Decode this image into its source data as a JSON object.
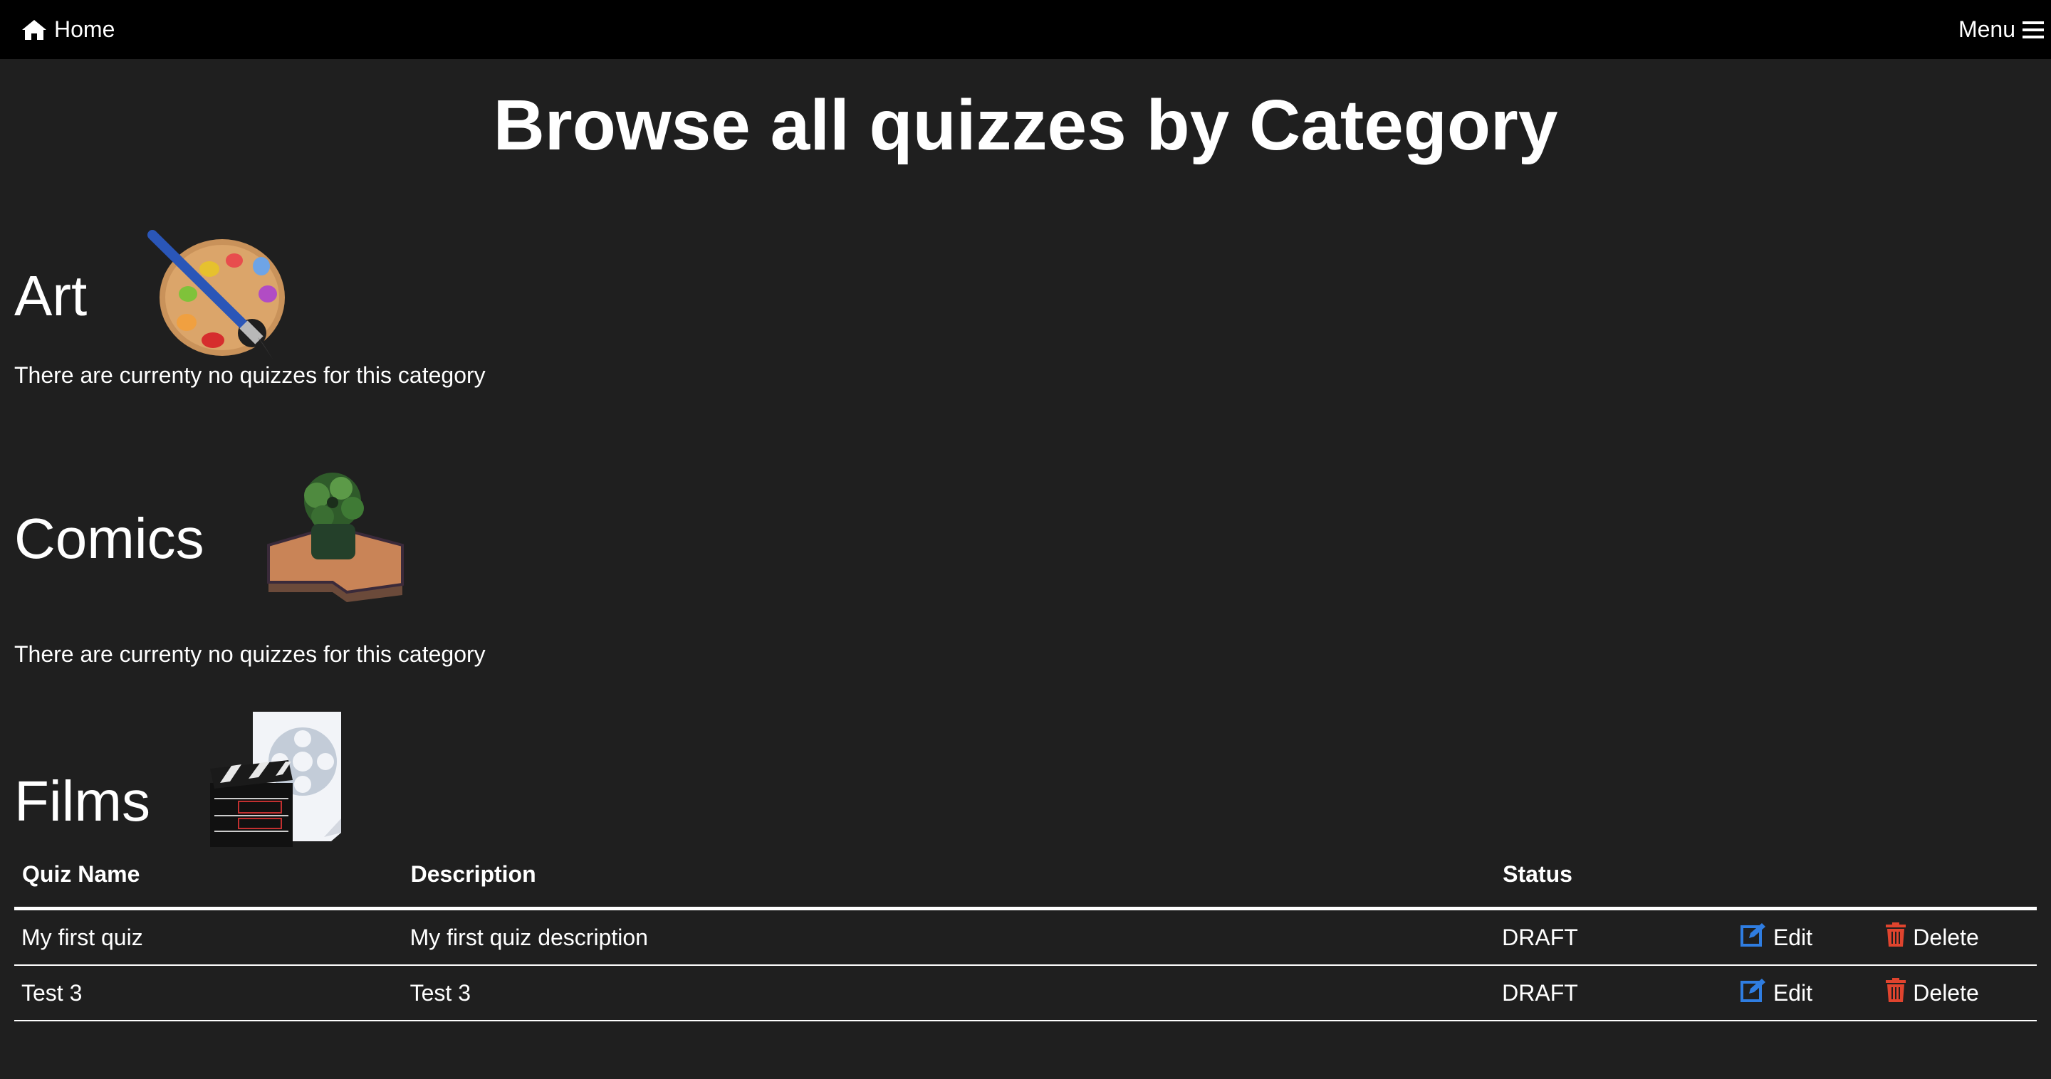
{
  "nav": {
    "home_label": "Home",
    "menu_label": "Menu",
    "home_icon": "home-icon",
    "menu_icon": "hamburger-icon"
  },
  "page": {
    "title": "Browse all quizzes by Category"
  },
  "categories": [
    {
      "name": "Art",
      "icon": "palette-icon",
      "empty_message": "There are currenty no quizzes for this category"
    },
    {
      "name": "Comics",
      "icon": "comics-hulk-icon",
      "empty_message": "There are currenty no quizzes for this category"
    },
    {
      "name": "Films",
      "icon": "film-clapperboard-icon",
      "table": {
        "headers": [
          "Quiz Name",
          "Description",
          "Status"
        ],
        "rows": [
          {
            "name": "My first quiz",
            "description": "My first quiz description",
            "status": "DRAFT",
            "edit_label": "Edit",
            "delete_label": "Delete"
          },
          {
            "name": "Test 3",
            "description": "Test 3",
            "status": "DRAFT",
            "edit_label": "Edit",
            "delete_label": "Delete"
          }
        ]
      }
    }
  ],
  "colors": {
    "background": "#1f1f1f",
    "navbar": "#000000",
    "edit_icon": "#2f7de1",
    "delete_icon": "#e0442e"
  }
}
